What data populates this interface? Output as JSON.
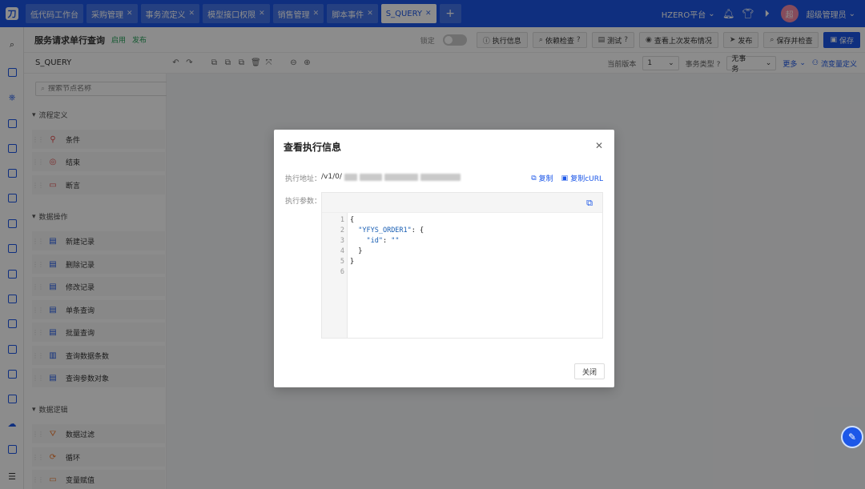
{
  "topbar": {
    "logo_glyph": "刀",
    "tabs": [
      {
        "label": "低代码工作台",
        "closable": false,
        "active": false
      },
      {
        "label": "采购管理",
        "closable": true,
        "active": false
      },
      {
        "label": "事务流定义",
        "closable": true,
        "active": false
      },
      {
        "label": "模型接口权限",
        "closable": true,
        "active": false
      },
      {
        "label": "销售管理",
        "closable": true,
        "active": false
      },
      {
        "label": "脚本事件",
        "closable": true,
        "active": false
      },
      {
        "label": "S_QUERY",
        "closable": true,
        "active": true
      }
    ],
    "add_tab": "+",
    "platform": "HZERO平台",
    "avatar_text": "超",
    "username": "超级管理员"
  },
  "header": {
    "title": "服务请求单行查询",
    "status_enabled": "启用",
    "status_published": "发布",
    "lock_label": "锁定",
    "buttons": {
      "exec_info": "执行信息",
      "dependency_check": "依赖检查",
      "test": "测试",
      "last_publish": "查看上次发布情况",
      "publish": "发布",
      "save_check": "保存并检查",
      "save": "保存"
    }
  },
  "toolbar": {
    "code": "S_QUERY",
    "version_label": "当前版本",
    "version_value": "1",
    "tx_type_label": "事务类型",
    "tx_type_value": "无事务",
    "more": "更多",
    "flow_vars": "流变量定义"
  },
  "nodes": {
    "search_placeholder": "搜索节点名称",
    "groups": [
      {
        "title": "流程定义",
        "items": [
          "条件",
          "结束",
          "断言"
        ]
      },
      {
        "title": "数据操作",
        "items": [
          "新建记录",
          "删除记录",
          "修改记录",
          "单条查询",
          "批量查询",
          "查询数据条数",
          "查询参数对象"
        ]
      },
      {
        "title": "数据逻辑",
        "items": [
          "数据过滤",
          "循环",
          "变量赋值"
        ]
      }
    ]
  },
  "modal": {
    "title": "查看执行信息",
    "url_label": "执行地址：",
    "url_prefix": "/v1/0/",
    "copy": "复制",
    "copy_curl": "复制cURL",
    "params_label": "执行参数：",
    "line_numbers": [
      "1",
      "2",
      "3",
      "4",
      "5",
      "6"
    ],
    "code": {
      "l1": "{",
      "l2_key": "\"YFYS_ORDER1\"",
      "l2_rest": ": {",
      "l3_key": "\"id\"",
      "l3_colon": ": ",
      "l3_val": "\"\"",
      "l4": "  }",
      "l5": "}"
    },
    "close": "关闭"
  },
  "colors": {
    "brand": "#1c57e8",
    "success": "#27a35b"
  }
}
